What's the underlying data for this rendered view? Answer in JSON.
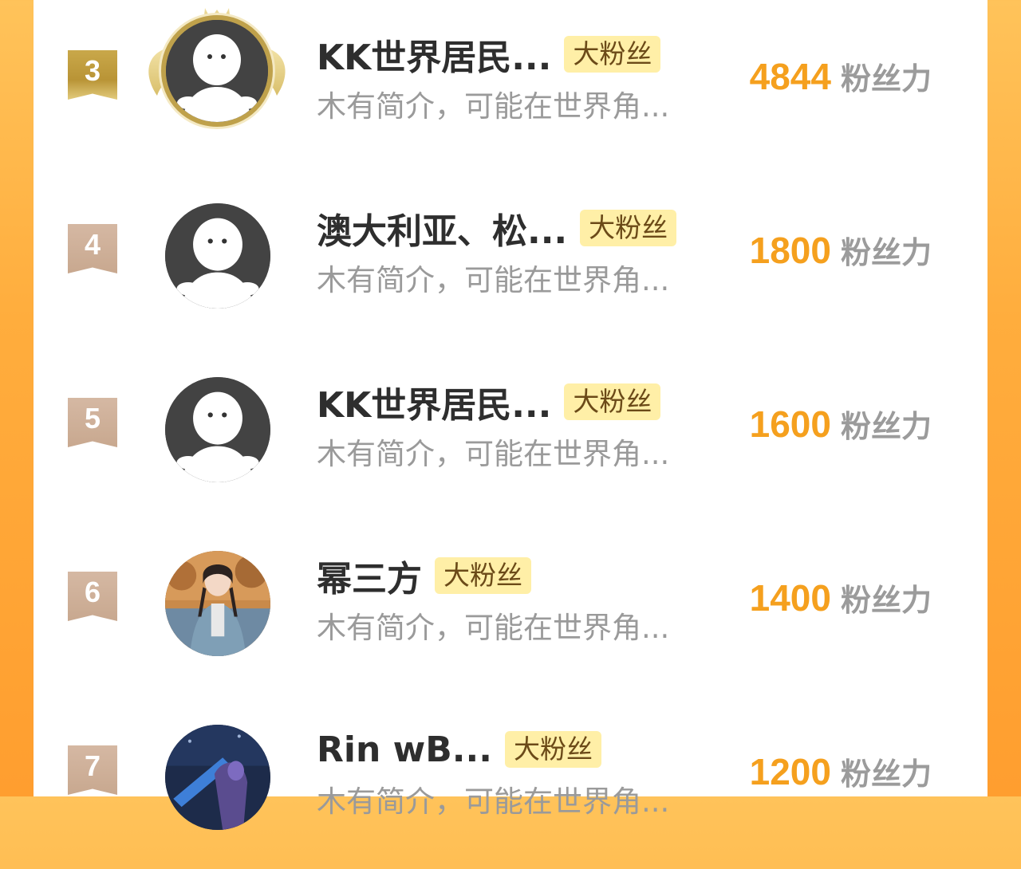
{
  "colors": {
    "score": "#f5a01e",
    "tag_bg": "#ffefa7",
    "tag_text": "#6b4a18",
    "gold_badge": "#c9a84a",
    "bronze_badge": "#d5b8a3",
    "background_orange": "#ffad3d"
  },
  "rows": [
    {
      "rank": "3",
      "name": "KK世界居民...",
      "tag": "大粉丝",
      "bio": "木有简介，可能在世界角...",
      "score": "4844",
      "score_unit": "粉丝力",
      "avatar": "default-avatar-icon",
      "crowned": true
    },
    {
      "rank": "4",
      "name": "澳大利亚、松...",
      "tag": "大粉丝",
      "bio": "木有简介，可能在世界角...",
      "score": "1800",
      "score_unit": "粉丝力",
      "avatar": "default-avatar-icon"
    },
    {
      "rank": "5",
      "name": "KK世界居民...",
      "tag": "大粉丝",
      "bio": "木有简介，可能在世界角...",
      "score": "1600",
      "score_unit": "粉丝力",
      "avatar": "default-avatar-icon"
    },
    {
      "rank": "6",
      "name": "幂三方",
      "tag": "大粉丝",
      "bio": "木有简介，可能在世界角...",
      "score": "1400",
      "score_unit": "粉丝力",
      "avatar": "photo-avatar"
    },
    {
      "rank": "7",
      "name": "Rin  wB...",
      "tag": "大粉丝",
      "bio": "木有简介，可能在世界角...",
      "score": "1200",
      "score_unit": "粉丝力",
      "avatar": "game-avatar"
    }
  ]
}
